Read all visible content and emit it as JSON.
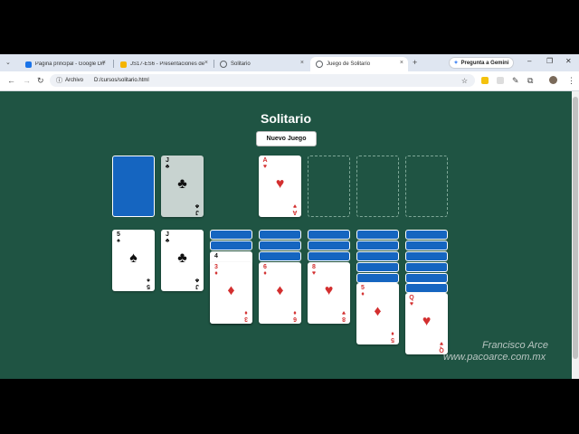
{
  "browser": {
    "tabs": [
      {
        "label": "Página principal - Google Drive",
        "color": "#1a73e8"
      },
      {
        "label": "JS17-ES6 - Presentaciones de",
        "color": "#f4b400"
      },
      {
        "label": "Solitario",
        "color": "#5f6368"
      },
      {
        "label": "Juego de Solitario",
        "color": "#5f6368"
      }
    ],
    "file_chip": "Archivo",
    "url": "D:/cursos/solitario.html",
    "gemini_label": "Pregunta a Gemini"
  },
  "game": {
    "title": "Solitario",
    "new_game_label": "Nuevo Juego",
    "waste": {
      "rank": "J",
      "suit": "♣"
    },
    "foundations": [
      {
        "rank": "A",
        "suit": "♥"
      },
      null,
      null,
      null
    ],
    "tableau": [
      {
        "hidden": 0,
        "top": {
          "rank": "5",
          "suit": "♠"
        }
      },
      {
        "hidden": 0,
        "top": {
          "rank": "J",
          "suit": "♣"
        }
      },
      {
        "hidden": 2,
        "visible": [
          "4",
          "3"
        ],
        "suits": [
          "♦",
          "♦"
        ]
      },
      {
        "hidden": 3,
        "top": {
          "rank": "6",
          "suit": "♦"
        }
      },
      {
        "hidden": 3,
        "top": {
          "rank": "8",
          "suit": "♥"
        }
      },
      {
        "hidden": 5,
        "top": {
          "rank": "5",
          "suit": "♦"
        }
      },
      {
        "hidden": 6,
        "top": {
          "rank": "Q",
          "suit": "♥"
        }
      }
    ]
  },
  "watermark": {
    "line1": "Francisco Arce",
    "line2": "www.pacoarce.com.mx"
  },
  "colors": {
    "table": "#1f5443",
    "card_back": "#1565c0",
    "red_suit": "#d32f2f"
  }
}
